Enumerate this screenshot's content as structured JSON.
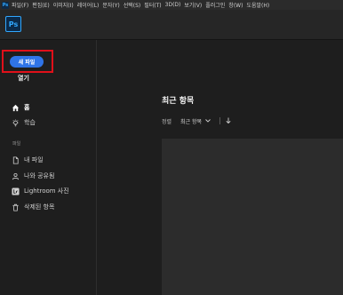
{
  "app": {
    "logo_text": "Ps"
  },
  "menubar": {
    "items": [
      "파일(F)",
      "편집(E)",
      "이미지(I)",
      "레이어(L)",
      "문자(Y)",
      "선택(S)",
      "필터(T)",
      "3D(D)",
      "보기(V)",
      "플러그인",
      "창(W)",
      "도움말(H)"
    ]
  },
  "sidebar": {
    "new_file_label": "새 파일",
    "open_label": "열기",
    "nav": [
      {
        "label": "홈",
        "icon": "home-icon"
      },
      {
        "label": "학습",
        "icon": "lightbulb-icon"
      }
    ],
    "files_section_label": "파일",
    "files": [
      {
        "label": "내 파일",
        "icon": "file-icon"
      },
      {
        "label": "나와 공유됨",
        "icon": "shared-user-icon"
      },
      {
        "label": "Lightroom 사진",
        "icon": "lightroom-icon"
      },
      {
        "label": "삭제된 항목",
        "icon": "trash-icon"
      }
    ]
  },
  "main": {
    "title": "최근 항목",
    "sort_label": "정렬",
    "sort_value": "최근 항목",
    "colors": {
      "accent": "#2f74e8",
      "highlight": "#e0101a"
    }
  }
}
